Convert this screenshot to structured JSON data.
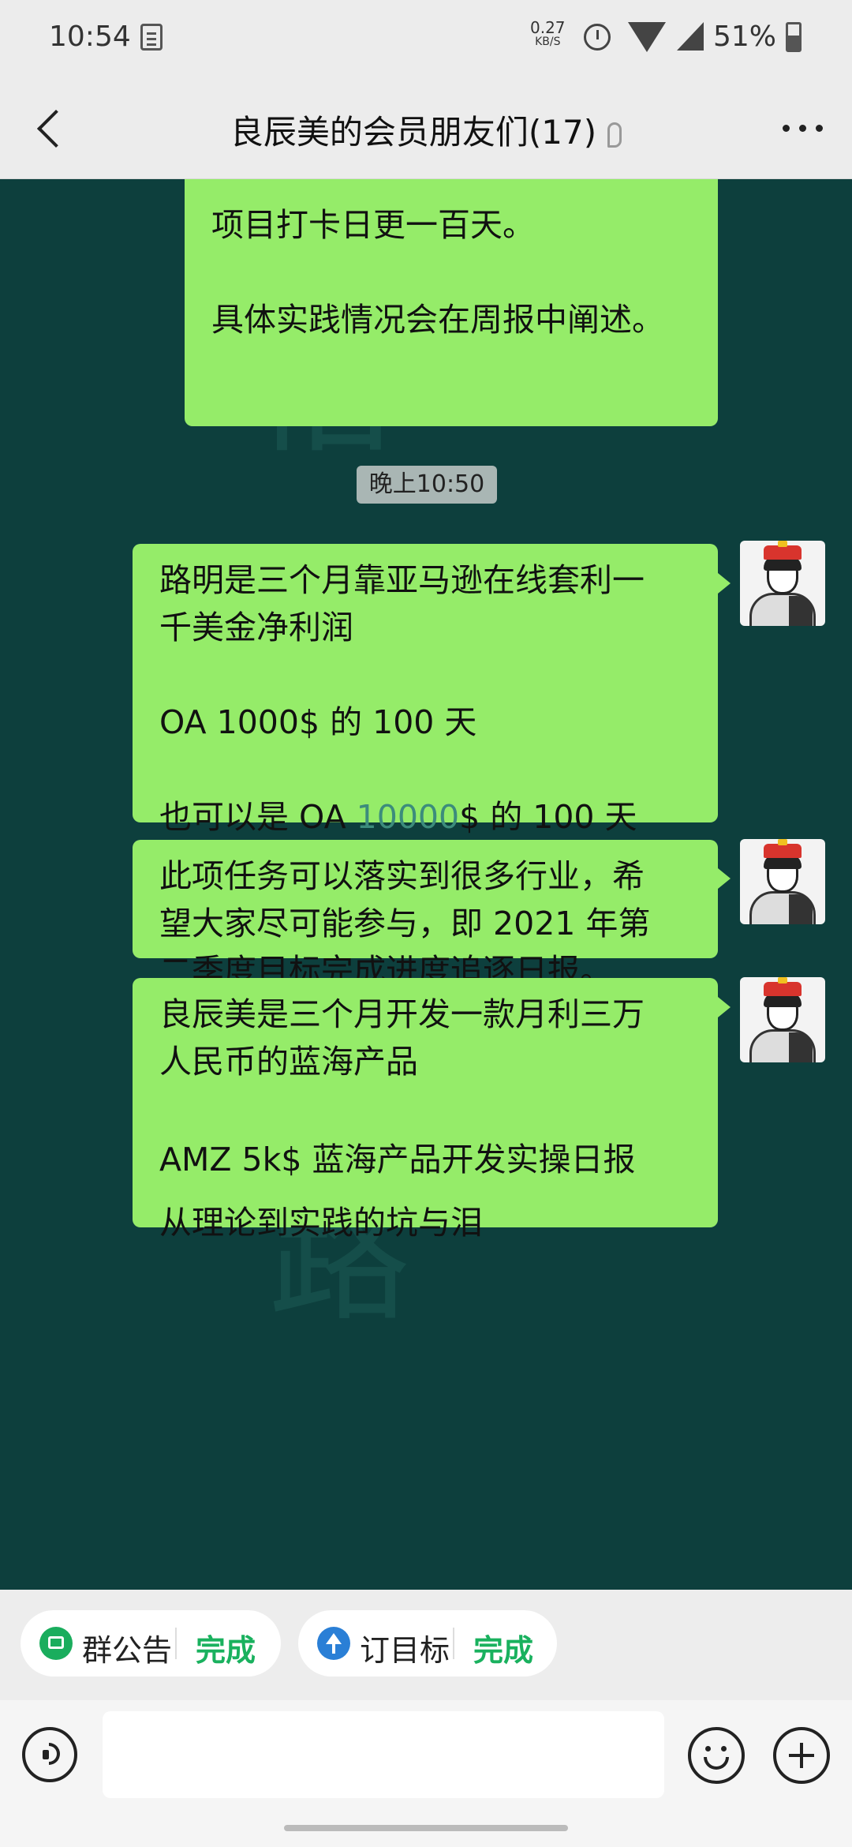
{
  "status_bar": {
    "time": "10:54",
    "net_speed_value": "0.27",
    "net_speed_unit": "KB/S",
    "battery": "51%"
  },
  "header": {
    "title": "良辰美的会员朋友们(17)"
  },
  "messages": {
    "m0": {
      "lines": [
        "项目打卡日更一百天。",
        "",
        "",
        "具体实践情况会在周报中阐述。"
      ]
    },
    "timestamp": "晚上10:50",
    "m1": {
      "line1": "路明是三个月靠亚马逊在线套利一",
      "line2": "千美金净利润",
      "line3": "OA 1000$ 的 100 天",
      "line4_prefix": "也可以是 OA ",
      "line4_num": "10000",
      "line4_suffix": "$ 的 100 天"
    },
    "m2": {
      "line1": "此项任务可以落实到很多行业，希",
      "line2": "望大家尽可能参与，即 2021 年第",
      "line3": "二季度目标完成进度追逐日报。"
    },
    "m3": {
      "line1": "良辰美是三个月开发一款月利三万",
      "line2": "人民币的蓝海产品",
      "line3": "AMZ 5k$ 蓝海产品开发实操日报",
      "line4": "从理论到实践的坑与泪"
    }
  },
  "quick_actions": {
    "notice_label": "群公告",
    "notice_status": "完成",
    "goal_label": "订目标",
    "goal_status": "完成"
  },
  "input": {
    "value": ""
  },
  "colors": {
    "chat_bg": "#0d3f3d",
    "bubble": "#95ec69",
    "done_green": "#19b15e"
  },
  "icons": {
    "back": "chevron-left-icon",
    "more": "more-icon",
    "voice": "voice-icon",
    "emoji": "emoji-icon",
    "add": "plus-icon"
  }
}
